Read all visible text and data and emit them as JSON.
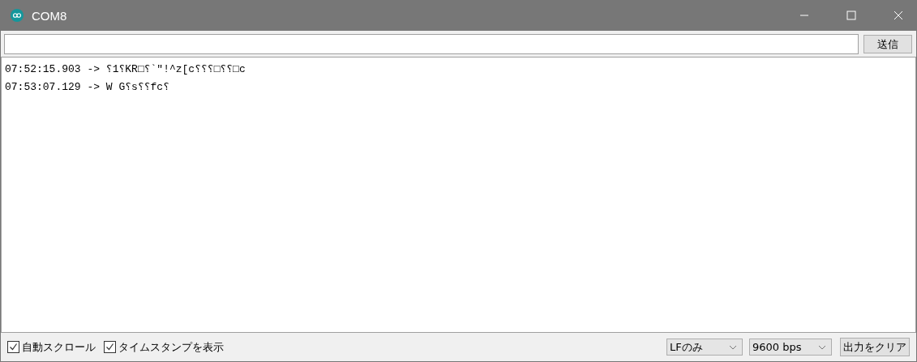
{
  "window": {
    "title": "COM8"
  },
  "send_button": "送信",
  "output_lines": [
    {
      "time": "07:52:15.903",
      "arrow": "->",
      "text": "⸮1⸮KR□⸮`\"!^z[c⸮⸮⸮□⸮⸮□c"
    },
    {
      "time": "07:53:07.129",
      "arrow": "->",
      "text": "W G⸮s⸮⸮fc⸮"
    }
  ],
  "options": [
    {
      "label": "自動スクロール",
      "checked": true
    },
    {
      "label": "タイムスタンプを表示",
      "checked": true
    }
  ],
  "line_ending": "LFのみ",
  "baud_rate": "9600 bps",
  "clear_button": "出力をクリア"
}
